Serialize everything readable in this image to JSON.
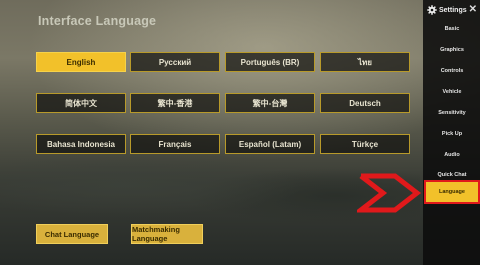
{
  "page": {
    "title": "Interface Language"
  },
  "languages": [
    {
      "label": "English",
      "active": true
    },
    {
      "label": "Русский"
    },
    {
      "label": "Português (BR)"
    },
    {
      "label": "ไทย"
    },
    {
      "label": "简体中文"
    },
    {
      "label": "繁中-香港"
    },
    {
      "label": "繁中-台灣"
    },
    {
      "label": "Deutsch"
    },
    {
      "label": "Bahasa Indonesia"
    },
    {
      "label": "Français"
    },
    {
      "label": "Español (Latam)"
    },
    {
      "label": "Türkçe"
    }
  ],
  "bottom_buttons": {
    "chat_language": "Chat Language",
    "matchmaking_language": "Matchmaking Language"
  },
  "sidebar": {
    "title": "Settings",
    "close_icon": "close-icon",
    "gear_icon": "gear-icon",
    "items": [
      {
        "label": "Basic"
      },
      {
        "label": "Graphics"
      },
      {
        "label": "Controls"
      },
      {
        "label": "Vehicle"
      },
      {
        "label": "Sensitivity"
      },
      {
        "label": "Pick Up"
      },
      {
        "label": "Audio"
      },
      {
        "label": "Quick Chat"
      },
      {
        "label": "Language",
        "active": true
      }
    ]
  },
  "colors": {
    "accent": "#f2c12a",
    "border": "#b89a2a",
    "highlight_red": "#e0191b"
  }
}
